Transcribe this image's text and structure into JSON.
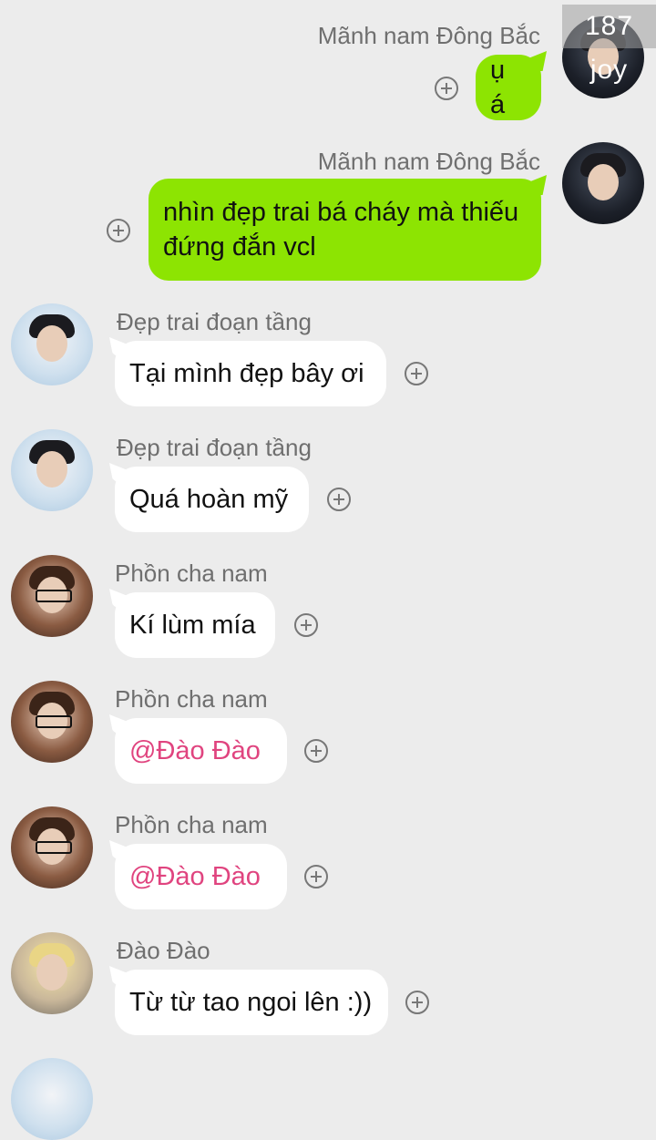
{
  "watermark": "187 joy",
  "messages": [
    {
      "sender": "Mãnh nam Đông Bắc",
      "text": "ụ á",
      "avatar": "dark-hair-boy"
    },
    {
      "sender": "Mãnh nam Đông Bắc",
      "text": "nhìn đẹp trai bá cháy mà thiếu đứng đắn vcl",
      "avatar": "dark-hair-boy"
    },
    {
      "sender": "Đẹp trai đoạn tầng",
      "text": "Tại mình đẹp bây ơi",
      "avatar": "light-blue-boy"
    },
    {
      "sender": "Đẹp trai đoạn tầng",
      "text": "Quá hoàn mỹ",
      "avatar": "light-blue-boy"
    },
    {
      "sender": "Phồn cha nam",
      "text": "Kí lùm mía",
      "avatar": "glasses-boy"
    },
    {
      "sender": "Phồn cha nam",
      "text": "@Đào Đào",
      "avatar": "glasses-boy"
    },
    {
      "sender": "Phồn cha nam",
      "text": "@Đào Đào",
      "avatar": "glasses-boy"
    },
    {
      "sender": "Đào Đào",
      "text": "Từ từ tao ngoi lên :))",
      "avatar": "blond-boy"
    }
  ],
  "colors": {
    "background": "#ececec",
    "outgoing_bubble": "#8de402",
    "incoming_bubble": "#ffffff",
    "mention": "#e0447f"
  },
  "icons": {
    "add_reaction": "plus-circle-icon"
  }
}
